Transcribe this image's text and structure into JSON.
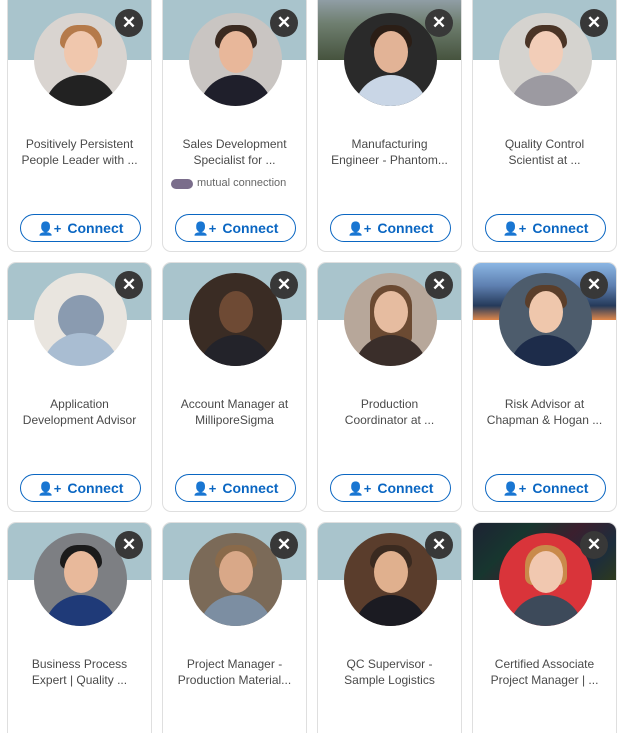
{
  "connect_label": "Connect",
  "close_symbol": "✕",
  "add_person_icon": "👤+",
  "cards": [
    {
      "headline": [
        "Positively Persistent",
        "People Leader with ..."
      ]
    },
    {
      "headline": [
        "Sales Development",
        "Specialist for ..."
      ],
      "mutual": "mutual connection"
    },
    {
      "headline": [
        "Manufacturing",
        "Engineer - Phantom..."
      ]
    },
    {
      "headline": [
        "Quality Control",
        "Scientist at ..."
      ]
    },
    {
      "headline": [
        "Application",
        "Development Advisor"
      ]
    },
    {
      "headline": [
        "Account Manager at",
        "MilliporeSigma"
      ]
    },
    {
      "headline": [
        "Production",
        "Coordinator at ..."
      ]
    },
    {
      "headline": [
        "Risk Advisor at",
        "Chapman & Hogan ..."
      ]
    },
    {
      "headline": [
        "Business Process",
        "Expert | Quality ..."
      ]
    },
    {
      "headline": [
        "Project Manager -",
        "Production Material..."
      ]
    },
    {
      "headline": [
        "QC Supervisor -",
        "Sample Logistics"
      ]
    },
    {
      "headline": [
        "Certified Associate",
        "Project Manager | ..."
      ]
    }
  ],
  "colors": {
    "accent": "#0a66c2",
    "banner": "#a9c4cc",
    "close_bg": "#383838"
  }
}
